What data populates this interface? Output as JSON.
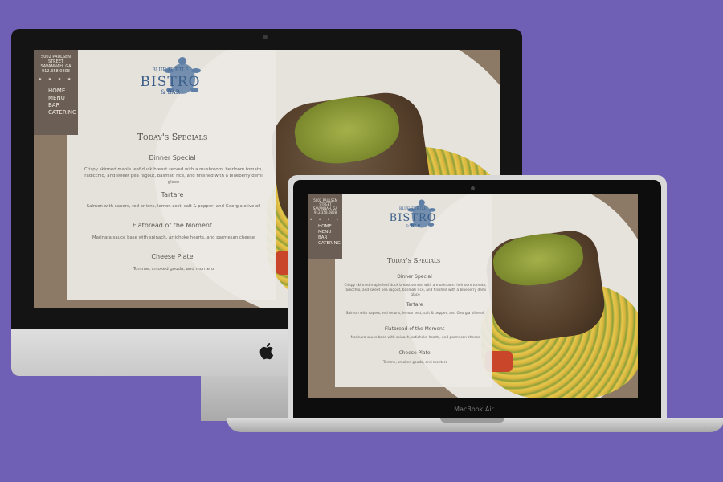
{
  "site": {
    "address_line1": "5002 PAULSEN",
    "address_line2": "STREET",
    "address_line3": "SAVANNAH, GA",
    "phone": "912.358.0808",
    "stars": "★ ★ ★ ★",
    "logo_line1": "BLUE TURTLE",
    "logo_line2": "BISTRO",
    "logo_line3": "& BAR",
    "nav": [
      "HOME",
      "MENU",
      "BAR",
      "CATERING"
    ]
  },
  "menu": {
    "title": "Today's Specials",
    "items": [
      {
        "name": "Dinner Special",
        "description": "Crispy skinned maple leaf duck breast served with a mushroom, heirloom tomato, radicchio, and sweet pea ragout, basmati rice, and finished with a blueberry demi glace"
      },
      {
        "name": "Tartare",
        "description": "Salmon with capers, red onions, lemon zest, salt & pepper, and Georgia olive oil"
      },
      {
        "name": "Flatbread of the Moment",
        "description": "Marinara sauce base with spinach, artichoke hearts, and parmesan cheese"
      },
      {
        "name": "Cheese Plate",
        "description": "Tomme, smoked gouda, and montero"
      }
    ]
  },
  "devices": {
    "laptop_label": "MacBook Air"
  },
  "colors": {
    "background": "#6f5fb5",
    "sidebar": "#6b5e54",
    "logo_blue": "#3b5f8a"
  }
}
